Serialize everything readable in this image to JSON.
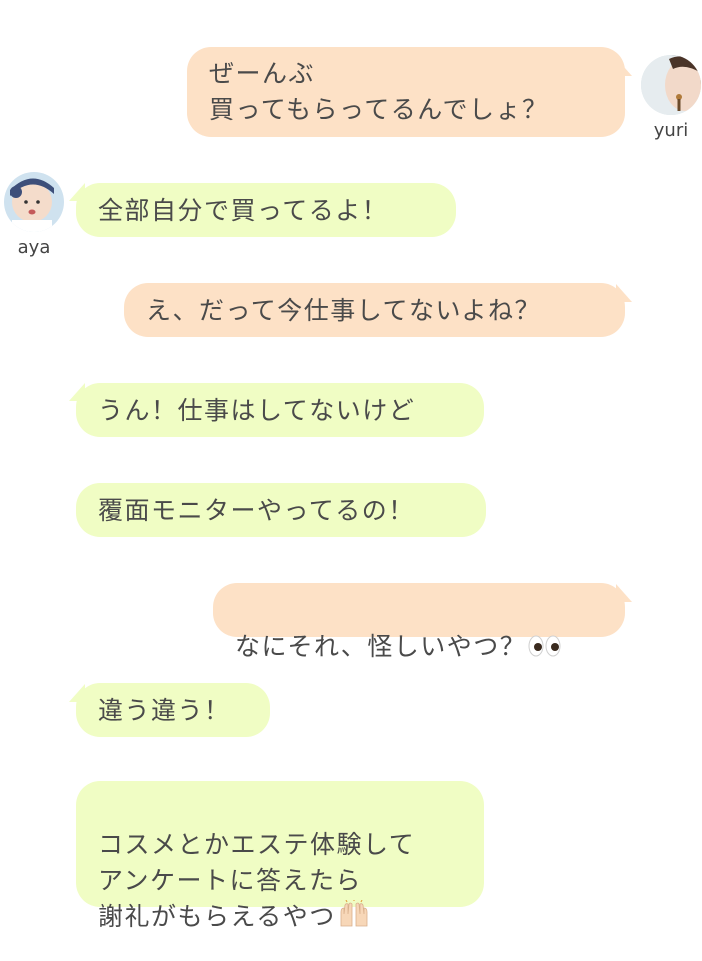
{
  "users": {
    "yuri": {
      "name": "yuri"
    },
    "aya": {
      "name": "aya"
    }
  },
  "messages": [
    {
      "sender": "yuri",
      "side": "right",
      "text": "ぜーんぶ\n買ってもらってるんでしょ？"
    },
    {
      "sender": "aya",
      "side": "left",
      "text": "全部自分で買ってるよ！"
    },
    {
      "sender": "yuri",
      "side": "right",
      "text": "え、だって今仕事してないよね？"
    },
    {
      "sender": "aya",
      "side": "left",
      "text": "うん！仕事はしてないけど"
    },
    {
      "sender": "aya",
      "side": "left",
      "text": "覆面モニターやってるの！"
    },
    {
      "sender": "yuri",
      "side": "right",
      "text": "なにそれ、怪しいやつ？",
      "emoji": "eyes-emoji"
    },
    {
      "sender": "aya",
      "side": "left",
      "text": "違う違う！"
    },
    {
      "sender": "aya",
      "side": "left",
      "text": "コスメとかエステ体験して\nアンケートに答えたら\n謝礼がもらえるやつ",
      "emoji": "raising-hands-emoji"
    }
  ],
  "colors": {
    "left_bubble": "#f0fdc4",
    "right_bubble": "#fde1c6",
    "text": "#4a4a4a"
  }
}
